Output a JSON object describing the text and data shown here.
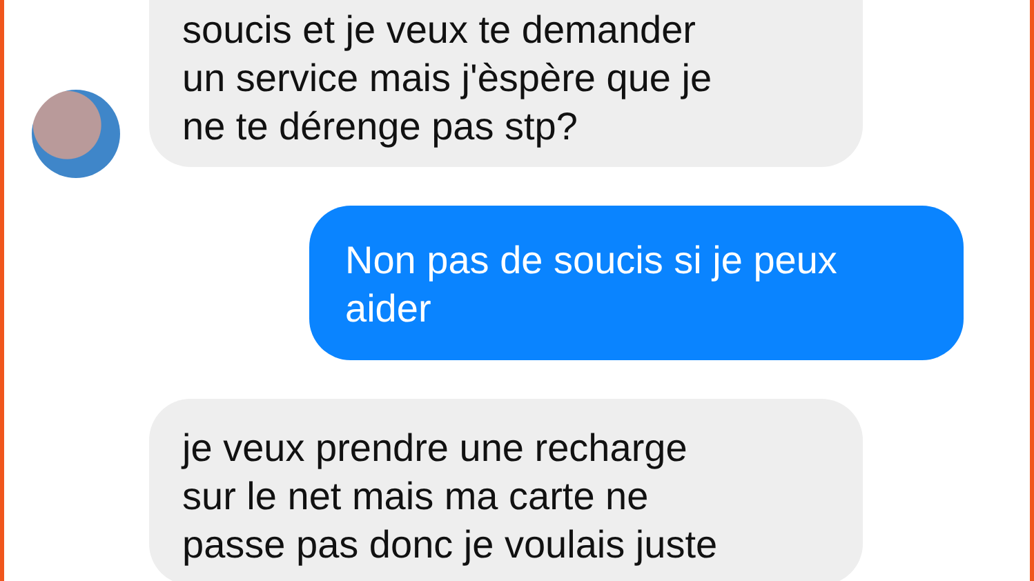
{
  "messages": [
    {
      "kind": "incoming",
      "avatar": true,
      "text": "soucis et je veux te demander\nun service mais j'èspère que je\nne te dérenge pas stp?"
    },
    {
      "kind": "outgoing",
      "avatar": false,
      "text": "Non pas de soucis si je peux\naider"
    },
    {
      "kind": "incoming",
      "avatar": false,
      "text": "je veux prendre une recharge\nsur le net mais ma carte ne\npasse pas donc je voulais juste"
    }
  ]
}
